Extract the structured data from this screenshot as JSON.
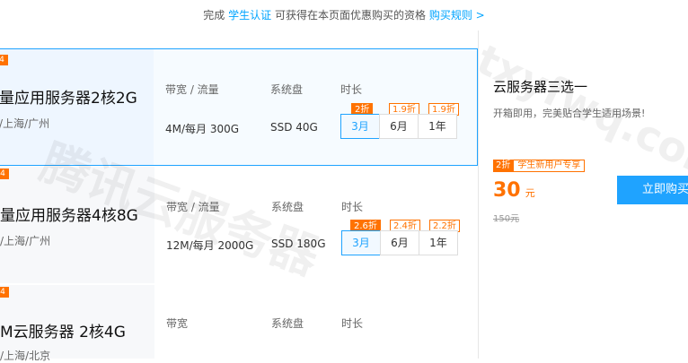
{
  "topbar": {
    "prefix": "完成",
    "verify_link": "学生认证",
    "middle": "可获得在本页面优惠购买的资格",
    "rules_link": "购买规则 >"
  },
  "products": [
    {
      "corner_tag": "4",
      "name": "量应用服务器2核2G",
      "region": "/上海/广州",
      "bandwidth_header": "带宽 / 流量",
      "bandwidth_value": "4M/每月 300G",
      "disk_header": "系统盘",
      "disk_value": "SSD 40G",
      "duration_header": "时长",
      "durations": [
        {
          "label": "3月",
          "discount": "2折",
          "active": true
        },
        {
          "label": "6月",
          "discount": "1.9折",
          "active": false
        },
        {
          "label": "1年",
          "discount": "1.9折",
          "active": false
        }
      ]
    },
    {
      "corner_tag": "4",
      "name": "量应用服务器4核8G",
      "region": "/上海/广州",
      "bandwidth_header": "带宽 / 流量",
      "bandwidth_value": "12M/每月 2000G",
      "disk_header": "系统盘",
      "disk_value": "SSD 180G",
      "duration_header": "时长",
      "durations": [
        {
          "label": "3月",
          "discount": "2.6折",
          "active": true
        },
        {
          "label": "6月",
          "discount": "2.4折",
          "active": false
        },
        {
          "label": "1年",
          "discount": "2.2折",
          "active": false
        }
      ]
    },
    {
      "corner_tag": "4",
      "name": "M云服务器 2核4G",
      "region": "/上海/北京",
      "bandwidth_header": "带宽",
      "disk_header": "系统盘",
      "duration_header": "时长"
    }
  ],
  "panel": {
    "title": "云服务器三选一",
    "subtitle": "开箱即用，完美贴合学生适用场景!",
    "discount_tag": "2折",
    "promo_tag": "学生新用户专享",
    "price": "30",
    "unit": "元",
    "original_price": "150元",
    "buy_label": "立即购买"
  },
  "watermarks": [
    "腾讯云服务器",
    "txyfwq.com"
  ],
  "colors": {
    "accent": "#1fa3ff",
    "discount": "#ff7200"
  }
}
